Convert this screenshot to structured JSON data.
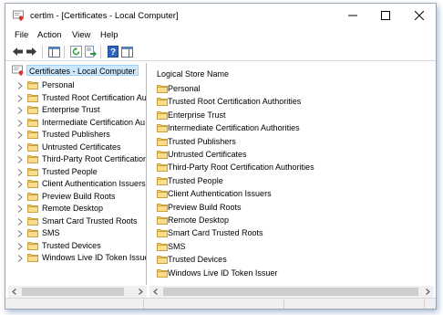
{
  "window": {
    "title": "certlm - [Certificates - Local Computer]",
    "accent": "#cce8ff"
  },
  "menubar": {
    "items": [
      "File",
      "Action",
      "View",
      "Help"
    ]
  },
  "toolbar": {
    "icons": [
      "back-arrow-icon",
      "forward-arrow-icon",
      "console-tree-icon",
      "refresh-icon",
      "export-list-icon",
      "help-icon",
      "properties-icon"
    ]
  },
  "tree": {
    "root_label": "Certificates - Local Computer",
    "items": [
      "Personal",
      "Trusted Root Certification Au",
      "Enterprise Trust",
      "Intermediate Certification Au",
      "Trusted Publishers",
      "Untrusted Certificates",
      "Third-Party Root Certification",
      "Trusted People",
      "Client Authentication Issuers",
      "Preview Build Roots",
      "Remote Desktop",
      "Smart Card Trusted Roots",
      "SMS",
      "Trusted Devices",
      "Windows Live ID Token Issuer"
    ]
  },
  "list": {
    "column_header": "Logical Store Name",
    "items": [
      "Personal",
      "Trusted Root Certification Authorities",
      "Enterprise Trust",
      "Intermediate Certification Authorities",
      "Trusted Publishers",
      "Untrusted Certificates",
      "Third-Party Root Certification Authorities",
      "Trusted People",
      "Client Authentication Issuers",
      "Preview Build Roots",
      "Remote Desktop",
      "Smart Card Trusted Roots",
      "SMS",
      "Trusted Devices",
      "Windows Live ID Token Issuer"
    ]
  }
}
